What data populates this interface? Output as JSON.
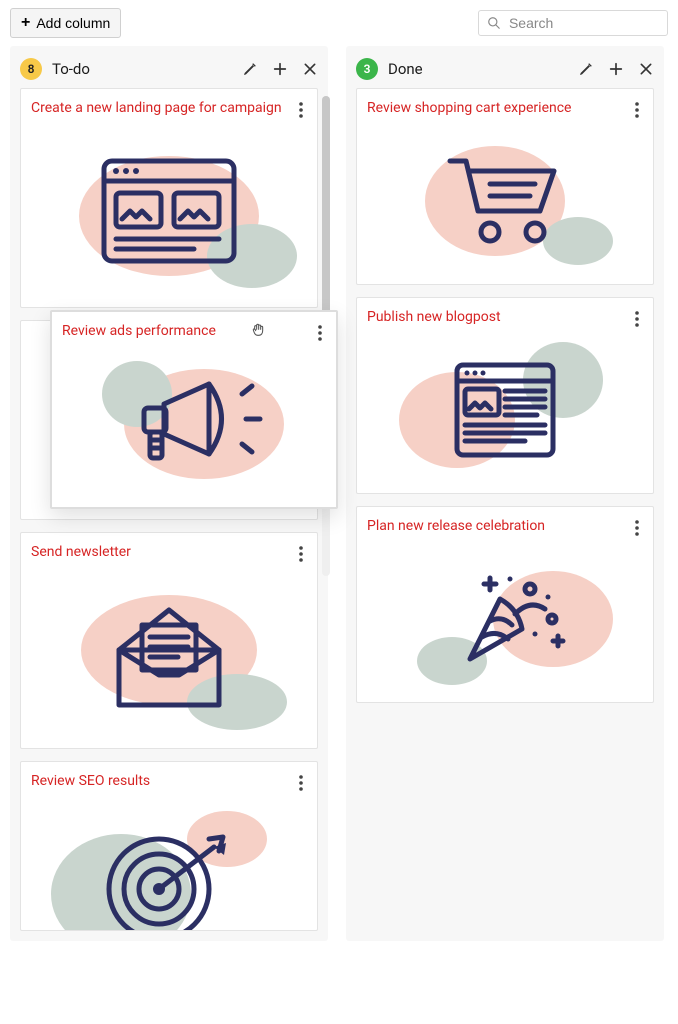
{
  "toolbar": {
    "add_column_label": "Add column",
    "search_placeholder": "Search"
  },
  "columns": [
    {
      "id": "todo",
      "title": "To-do",
      "count": "8",
      "badge_color": "yellow",
      "cards": [
        {
          "title": "Create a new landing page for campaign",
          "illus": "webpage"
        },
        {
          "title": "Review ads performance",
          "illus": "megaphone",
          "dragging": true
        },
        {
          "title": "Send newsletter",
          "illus": "envelope"
        },
        {
          "title": "Review SEO results",
          "illus": "target"
        }
      ]
    },
    {
      "id": "done",
      "title": "Done",
      "count": "3",
      "badge_color": "green",
      "cards": [
        {
          "title": "Review shopping cart experience",
          "illus": "cart"
        },
        {
          "title": "Publish new blogpost",
          "illus": "article"
        },
        {
          "title": "Plan new release celebration",
          "illus": "confetti"
        }
      ]
    }
  ]
}
